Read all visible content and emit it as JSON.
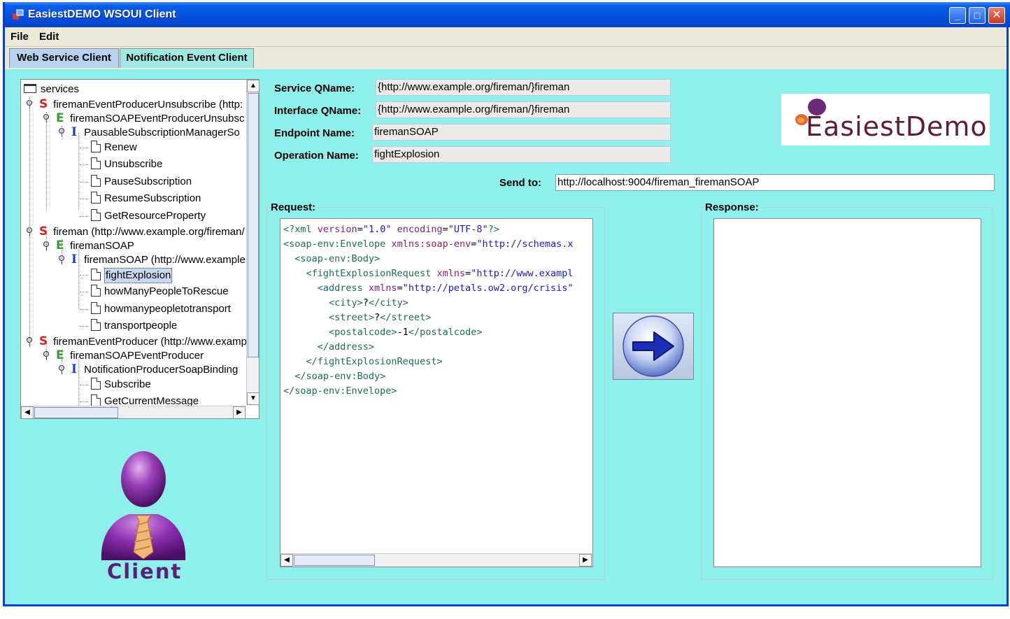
{
  "window": {
    "title": "EasiestDEMO WSOUI Client",
    "controls": {
      "minimize": "_",
      "maximize": "□",
      "close": "✕"
    }
  },
  "menu": {
    "items": [
      "File",
      "Edit"
    ]
  },
  "tabs": [
    {
      "label": "Web Service Client",
      "active": true
    },
    {
      "label": "Notification Event Client",
      "active": false
    }
  ],
  "tree": {
    "root": "services",
    "rows": [
      {
        "type": "S",
        "label": "firemanEventProducerUnsubscribe (http:"
      },
      {
        "type": "E",
        "label": "firemanSOAPEventProducerUnsubsc"
      },
      {
        "type": "I",
        "label": "PausableSubscriptionManagerSo"
      },
      {
        "type": "op",
        "label": "Renew"
      },
      {
        "type": "op",
        "label": "Unsubscribe"
      },
      {
        "type": "op",
        "label": "PauseSubscription"
      },
      {
        "type": "op",
        "label": "ResumeSubscription"
      },
      {
        "type": "op",
        "label": "GetResourceProperty"
      },
      {
        "type": "S",
        "label": "fireman (http://www.example.org/fireman/"
      },
      {
        "type": "E",
        "label": "firemanSOAP"
      },
      {
        "type": "I",
        "label": "firemanSOAP (http://www.example"
      },
      {
        "type": "op",
        "label": "fightExplosion",
        "selected": true
      },
      {
        "type": "op",
        "label": "howManyPeopleToRescue"
      },
      {
        "type": "op",
        "label": "howmanypeopletotransport"
      },
      {
        "type": "op",
        "label": "transportpeople"
      },
      {
        "type": "S",
        "label": "firemanEventProducer (http://www.examp"
      },
      {
        "type": "E",
        "label": "firemanSOAPEventProducer"
      },
      {
        "type": "I",
        "label": "NotificationProducerSoapBinding"
      },
      {
        "type": "op",
        "label": "Subscribe"
      },
      {
        "type": "op",
        "label": "GetCurrentMessage"
      }
    ]
  },
  "form": {
    "service_qname": {
      "label": "Service QName:",
      "value": "{http://www.example.org/fireman/}fireman"
    },
    "interface_qname": {
      "label": "Interface QName:",
      "value": "{http://www.example.org/fireman/}fireman"
    },
    "endpoint_name": {
      "label": "Endpoint Name:",
      "value": "firemanSOAP"
    },
    "operation_name": {
      "label": "Operation Name:",
      "value": "fightExplosion"
    },
    "send_to": {
      "label": "Send to:",
      "value": "http://localhost:9004/fireman_firemanSOAP"
    }
  },
  "logo": {
    "text": "EasiestDemo"
  },
  "request": {
    "title": "Request:",
    "lines": [
      [
        [
          "c-tag",
          "<?xml "
        ],
        [
          "c-attr",
          "version"
        ],
        [
          "c-text",
          "="
        ],
        [
          "c-val",
          "\"1.0\""
        ],
        [
          "c-text",
          " "
        ],
        [
          "c-attr",
          "encoding"
        ],
        [
          "c-text",
          "="
        ],
        [
          "c-val",
          "\"UTF-8\""
        ],
        [
          "c-tag",
          "?>"
        ]
      ],
      [
        [
          "c-tag",
          "<soap-env:Envelope "
        ],
        [
          "c-attr",
          "xmlns:soap-env"
        ],
        [
          "c-text",
          "="
        ],
        [
          "c-val",
          "\"http://schemas.x"
        ]
      ],
      [
        [
          "c-tag",
          "  <soap-env:Body>"
        ]
      ],
      [
        [
          "c-tag",
          "    <fightExplosionRequest "
        ],
        [
          "c-attr",
          "xmlns"
        ],
        [
          "c-text",
          "="
        ],
        [
          "c-val",
          "\"http://www.exampl"
        ]
      ],
      [
        [
          "c-tag",
          "      <address "
        ],
        [
          "c-attr",
          "xmlns"
        ],
        [
          "c-text",
          "="
        ],
        [
          "c-val",
          "\"http://petals.ow2.org/crisis\""
        ]
      ],
      [
        [
          "c-tag",
          "        <city>"
        ],
        [
          "c-text",
          "?"
        ],
        [
          "c-tag",
          "</city>"
        ]
      ],
      [
        [
          "c-tag",
          "        <street>"
        ],
        [
          "c-text",
          "?"
        ],
        [
          "c-tag",
          "</street>"
        ]
      ],
      [
        [
          "c-tag",
          "        <postalcode>"
        ],
        [
          "c-text",
          "-1"
        ],
        [
          "c-tag",
          "</postalcode>"
        ]
      ],
      [
        [
          "c-tag",
          "      </address>"
        ]
      ],
      [
        [
          "c-tag",
          "    </fightExplosionRequest>"
        ]
      ],
      [
        [
          "c-tag",
          "  </soap-env:Body>"
        ]
      ],
      [
        [
          "c-tag",
          "</soap-env:Envelope>"
        ]
      ]
    ]
  },
  "response": {
    "title": "Response:",
    "body": ""
  },
  "send_button": {
    "icon": "arrow-right-icon"
  },
  "client_badge": {
    "label": "Client"
  },
  "colors": {
    "panel_bg": "#8ff0eb",
    "titlebar": "#0553e1",
    "accent_purple": "#5b1f78"
  }
}
